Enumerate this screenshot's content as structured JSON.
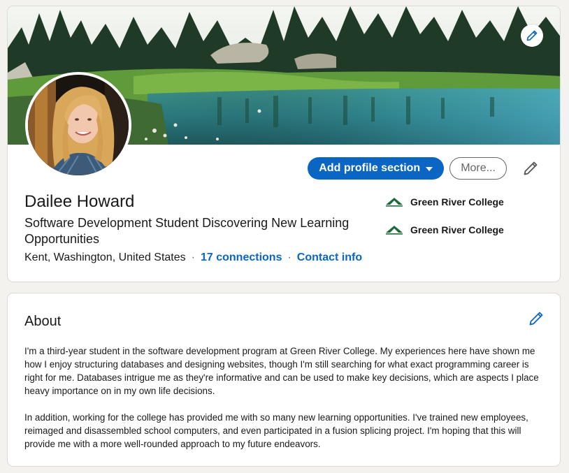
{
  "profile": {
    "name": "Dailee Howard",
    "headline": "Software Development Student Discovering New Learning Opportunities",
    "location": "Kent, Washington, United States",
    "connections_label": "17 connections",
    "contact_label": "Contact info"
  },
  "actions": {
    "add_section_label": "Add profile section",
    "more_label": "More..."
  },
  "education": [
    {
      "name": "Green River College"
    },
    {
      "name": "Green River College"
    }
  ],
  "about": {
    "title": "About",
    "paragraphs": [
      "I'm a third-year student in the software development program at Green River College. My experiences here have shown me how I enjoy structuring databases and designing websites, though I'm still searching for what exact programming career is right for me. Databases intrigue me as they're informative and can be used to make key decisions, which are aspects I place heavy importance on in my own life decisions.",
      "In addition, working for the college has provided me with so many new learning opportunities. I've trained new employees, reimaged and disassembled school computers, and even participated in a fusion splicing project. I'm hoping that this will provide me with a more well-rounded approach to my future endeavors."
    ]
  },
  "icons": {
    "cover_edit": "pencil-icon",
    "intro_edit": "pencil-icon",
    "about_edit": "pencil-icon"
  },
  "colors": {
    "primary": "#0a66c2",
    "page_bg": "#f3f2ef",
    "card_bg": "#ffffff",
    "school_logo": "#1e6b3a"
  }
}
